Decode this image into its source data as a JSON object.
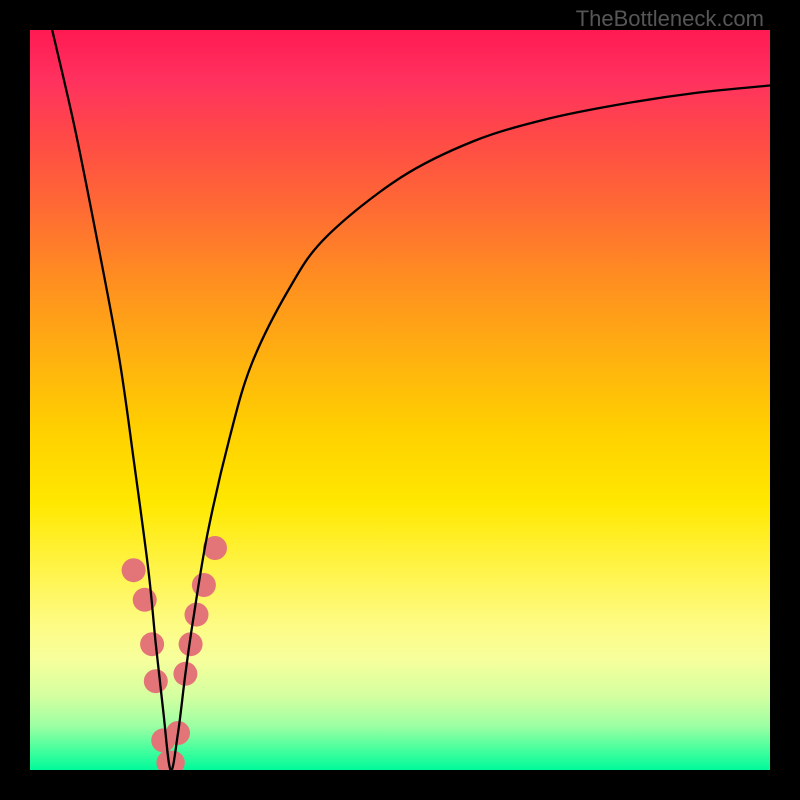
{
  "watermark": "TheBottleneck.com",
  "chart_data": {
    "type": "line",
    "title": "",
    "xlabel": "",
    "ylabel": "",
    "xlim": [
      0,
      100
    ],
    "ylim": [
      0,
      100
    ],
    "x_optimum": 19,
    "gradient_stops": [
      {
        "pct": 0,
        "color": "#ff1a52"
      },
      {
        "pct": 14,
        "color": "#ff4848"
      },
      {
        "pct": 34,
        "color": "#ff8f20"
      },
      {
        "pct": 54,
        "color": "#ffd000"
      },
      {
        "pct": 73,
        "color": "#fff44a"
      },
      {
        "pct": 90,
        "color": "#d4ffa0"
      },
      {
        "pct": 100,
        "color": "#00fa9a"
      }
    ],
    "series": [
      {
        "name": "bottleneck-curve",
        "x": [
          3,
          6,
          9,
          12,
          14,
          16,
          17,
          18,
          19,
          20,
          21,
          22,
          24,
          27,
          30,
          35,
          40,
          50,
          60,
          70,
          80,
          90,
          100
        ],
        "values": [
          100,
          87,
          72,
          56,
          42,
          27,
          17,
          8,
          0,
          5,
          13,
          20,
          32,
          45,
          55,
          65,
          72,
          80,
          85,
          88,
          90,
          91.5,
          92.5
        ]
      }
    ],
    "markers": {
      "name": "sample-points",
      "x": [
        14,
        15.5,
        16.5,
        17,
        18,
        18.7,
        19.3,
        20,
        21,
        21.7,
        22.5,
        23.5,
        25
      ],
      "values": [
        27,
        23,
        17,
        12,
        4,
        1,
        1,
        5,
        13,
        17,
        21,
        25,
        30
      ],
      "color": "#e37578",
      "radius_px": 12
    }
  }
}
